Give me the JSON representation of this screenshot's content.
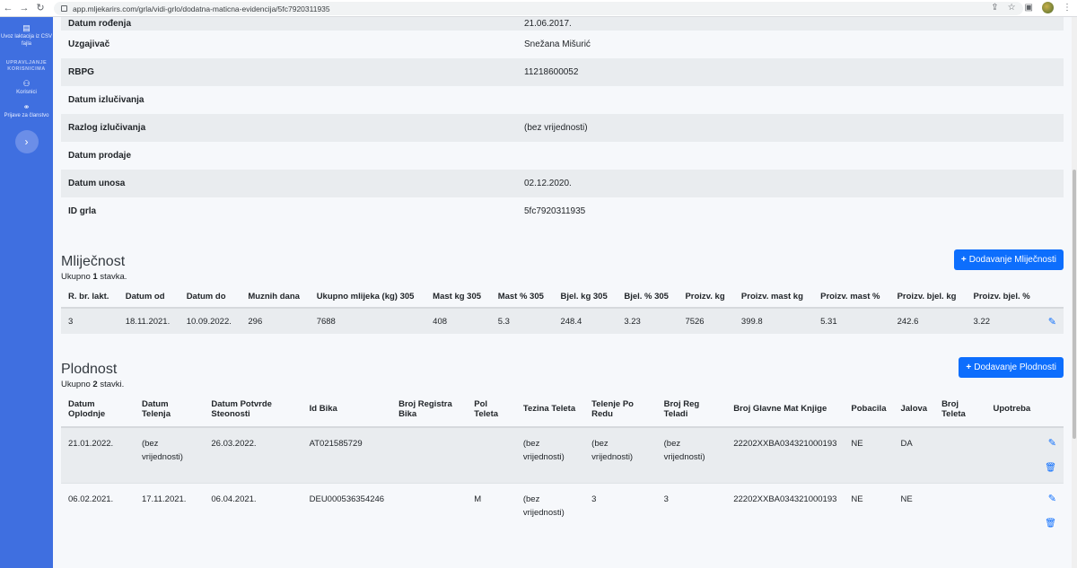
{
  "browser": {
    "url": "app.mljekarirs.com/grla/vidi-grlo/dodatna-maticna-evidencija/5fc7920311935"
  },
  "sidebar": {
    "item_import": "Uvoz laktacija iz CSV fajla",
    "heading": "UPRAVLJANJE KORISNICIMA",
    "item_users": "Korisnici",
    "item_membership": "Prijave za članstvo",
    "toggle": "›"
  },
  "details": [
    {
      "label": "Datum rođenja",
      "value": "21.06.2017."
    },
    {
      "label": "Uzgajivač",
      "value": "Snežana Mišurić"
    },
    {
      "label": "RBPG",
      "value": "11218600052"
    },
    {
      "label": "Datum izlučivanja",
      "value": ""
    },
    {
      "label": "Razlog izlučivanja",
      "value": "(bez vrijednosti)"
    },
    {
      "label": "Datum prodaje",
      "value": ""
    },
    {
      "label": "Datum unosa",
      "value": "02.12.2020."
    },
    {
      "label": "ID grla",
      "value": "5fc7920311935"
    }
  ],
  "mlijecnost": {
    "title": "Mliječnost",
    "add_button": "Dodavanje Mliječnosti",
    "count_prefix": "Ukupno ",
    "count": "1",
    "count_suffix": " stavka.",
    "headers": [
      "R. br. lakt.",
      "Datum od",
      "Datum do",
      "Muznih dana",
      "Ukupno mlijeka (kg) 305",
      "Mast kg 305",
      "Mast % 305",
      "Bjel. kg 305",
      "Bjel. % 305",
      "Proizv. kg",
      "Proizv. mast kg",
      "Proizv. mast %",
      "Proizv. bjel. kg",
      "Proizv. bjel. %"
    ],
    "rows": [
      [
        "3",
        "18.11.2021.",
        "10.09.2022.",
        "296",
        "7688",
        "408",
        "5.3",
        "248.4",
        "3.23",
        "7526",
        "399.8",
        "5.31",
        "242.6",
        "3.22"
      ]
    ]
  },
  "plodnost": {
    "title": "Plodnost",
    "add_button": "Dodavanje Plodnosti",
    "count_prefix": "Ukupno ",
    "count": "2",
    "count_suffix": " stavki.",
    "headers": [
      "Datum Oplodnje",
      "Datum Telenja",
      "Datum Potvrde Steonosti",
      "Id Bika",
      "Broj Registra Bika",
      "Pol Teleta",
      "Tezina Teleta",
      "Telenje Po Redu",
      "Broj Reg Teladi",
      "Broj Glavne Mat Knjige",
      "Pobacila",
      "Jalova",
      "Broj Teleta",
      "Upotreba"
    ],
    "rows": [
      [
        "21.01.2022.",
        "(bez vrijednosti)",
        "26.03.2022.",
        "AT021585729",
        "",
        "",
        "(bez vrijednosti)",
        "(bez vrijednosti)",
        "(bez vrijednosti)",
        "22202XXBA034321000193",
        "NE",
        "DA",
        "",
        ""
      ],
      [
        "06.02.2021.",
        "17.11.2021.",
        "06.04.2021.",
        "DEU000536354246",
        "",
        "M",
        "(bez vrijednosti)",
        "3",
        "3",
        "22202XXBA034321000193",
        "NE",
        "NE",
        "",
        ""
      ]
    ]
  },
  "icons": {
    "edit": "pencil-icon",
    "delete": "trash-icon"
  },
  "colors": {
    "sidebar": "#3f6fe0",
    "primary": "#0d6efd"
  }
}
